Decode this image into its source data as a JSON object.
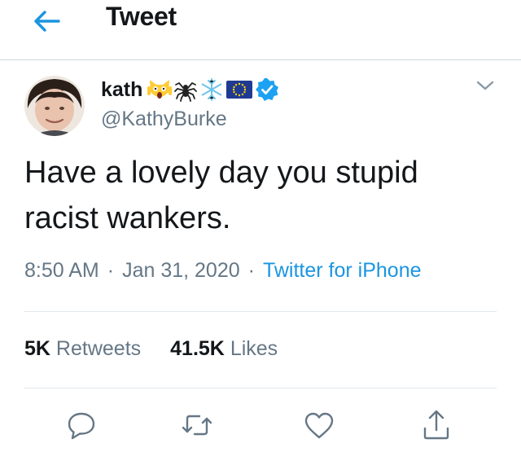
{
  "header": {
    "title": "Tweet",
    "back_icon": "arrow-left-icon"
  },
  "author": {
    "name": "kath",
    "handle": "@KathyBurke",
    "verified": true,
    "name_emojis": [
      "screaming-cat-emoji",
      "spider-emoji",
      "snowflake-emoji",
      "eu-flag-emoji"
    ]
  },
  "tweet": {
    "text": "Have a lovely day you stupid racist wankers.",
    "time": "8:50 AM",
    "date": "Jan 31, 2020",
    "separator": "·",
    "source": "Twitter for iPhone"
  },
  "stats": {
    "retweets_count": "5K",
    "retweets_label": "Retweets",
    "likes_count": "41.5K",
    "likes_label": "Likes"
  },
  "actions": [
    "reply-icon",
    "retweet-icon",
    "like-icon",
    "share-icon"
  ],
  "colors": {
    "accent": "#1b95e0",
    "secondary_text": "#657786",
    "divider": "#e1e8ed",
    "verified_badge": "#1da1f2"
  }
}
